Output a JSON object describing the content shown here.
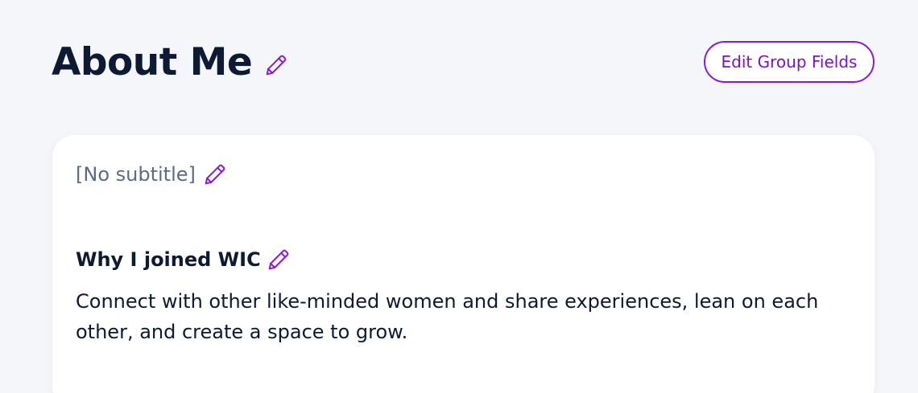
{
  "header": {
    "title": "About Me",
    "title_edit_icon": "pencil-icon",
    "edit_group_fields_label": "Edit Group Fields"
  },
  "card": {
    "subtitle": "[No subtitle]",
    "subtitle_edit_icon": "pencil-icon",
    "field": {
      "heading": "Why I joined WIC",
      "edit_icon": "pencil-icon",
      "body": "Connect with other like-minded women and share experiences, lean on each other, and create a space to grow."
    }
  },
  "colors": {
    "accent": "#8a19d8",
    "title_text": "#0c1a33",
    "muted_text": "#5c6b85",
    "page_background": "#f5f6fa",
    "card_background": "#ffffff"
  }
}
